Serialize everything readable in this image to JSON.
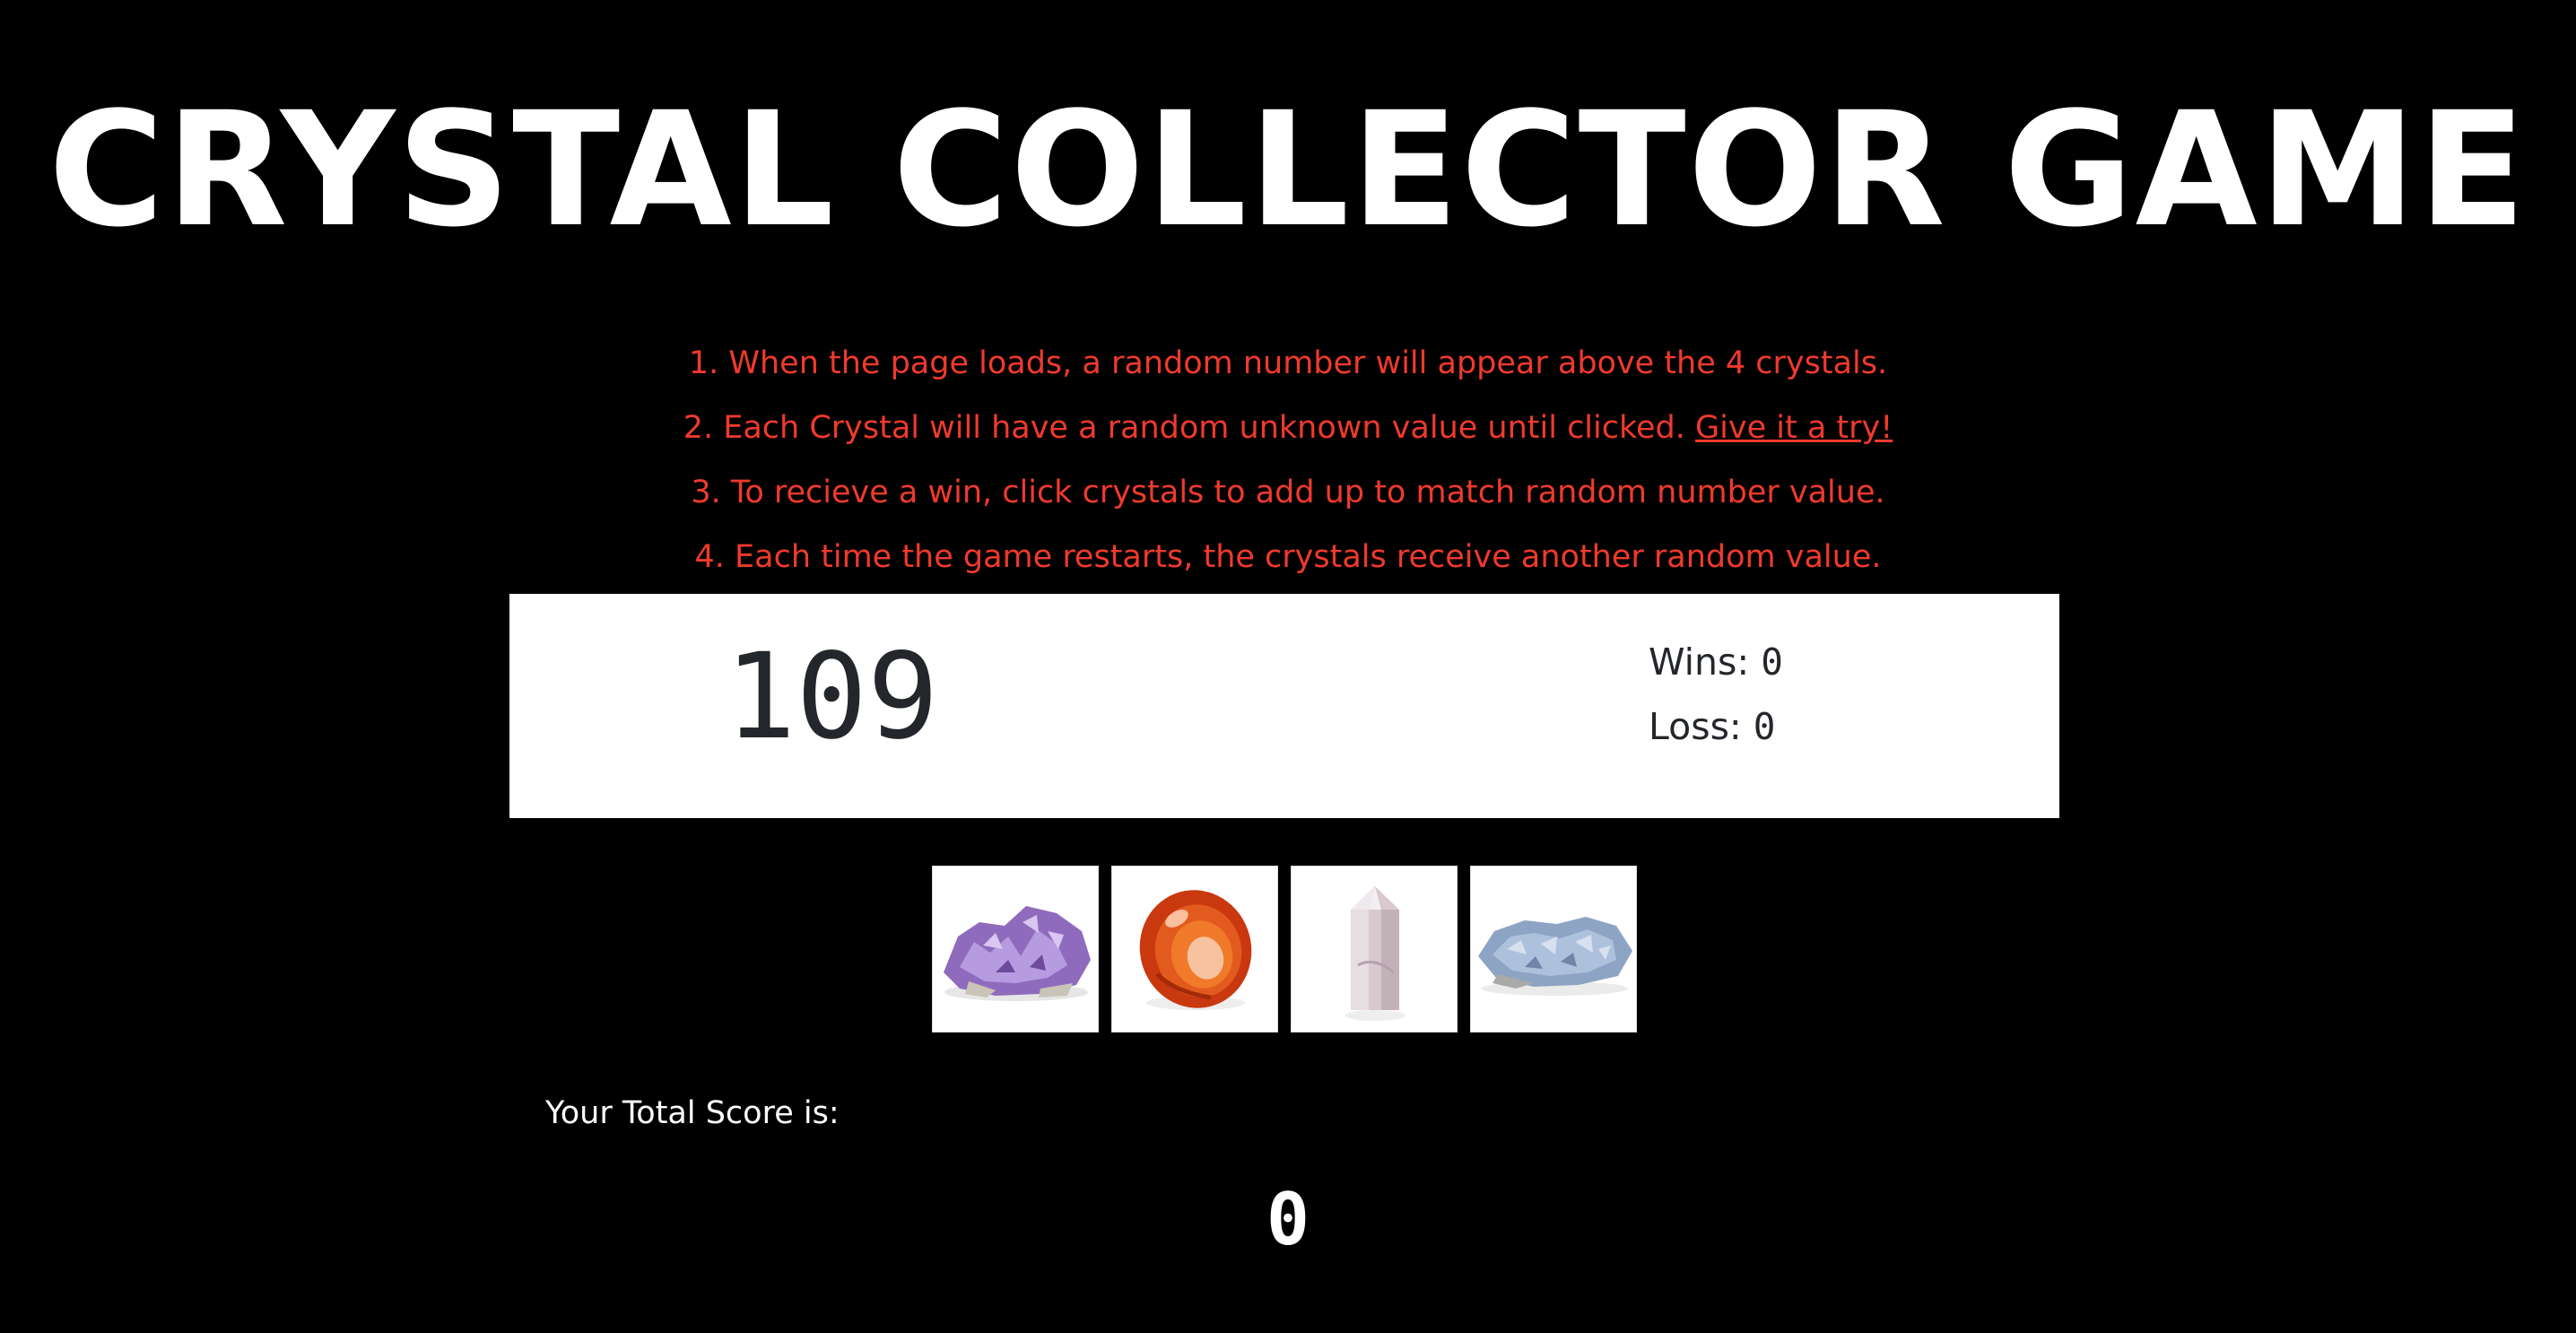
{
  "title": "CRYSTAL COLLECTOR GAME",
  "instructions": {
    "line1": "1. When the page loads, a random number will appear above the 4 crystals.",
    "line2_text": "2. Each Crystal will have a random unknown value until clicked. ",
    "line2_link": "Give it a try!",
    "line3": "3. To recieve a win, click crystals to add up to match random number value.",
    "line4": "4. Each time the game restarts, the crystals receive another random value."
  },
  "scoreboard": {
    "target_number": "109",
    "wins_label": "Wins: ",
    "wins_value": "0",
    "loss_label": "Loss: ",
    "loss_value": "0"
  },
  "crystals": [
    {
      "name": "amethyst-crystal",
      "color": "#9b7bc4"
    },
    {
      "name": "carnelian-crystal",
      "color": "#d5431a"
    },
    {
      "name": "quartz-crystal",
      "color": "#d9ccd3"
    },
    {
      "name": "celestite-crystal",
      "color": "#9fb3cf"
    }
  ],
  "total": {
    "label": "Your Total Score is:",
    "value": "0"
  },
  "colors": {
    "background": "#000000",
    "title": "#ffffff",
    "instructions": "#ef3a2c",
    "scoreboard_bg": "#ffffff",
    "scoreboard_text": "#23262b"
  }
}
